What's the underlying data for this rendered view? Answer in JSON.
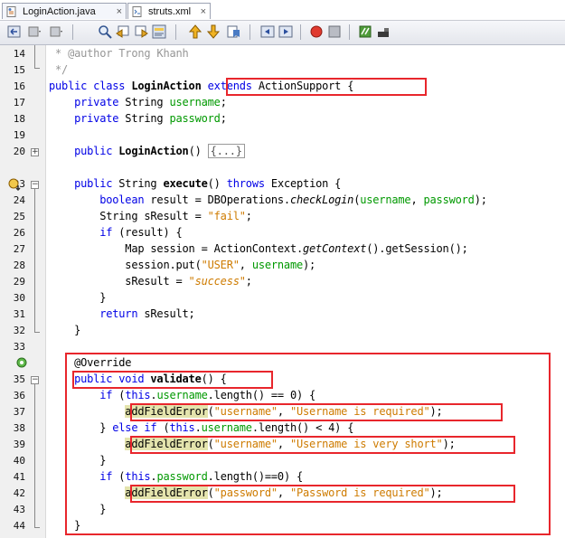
{
  "tabs": [
    {
      "label": "LoginAction.java",
      "icon": "java-file-icon",
      "close": "×",
      "active": true
    },
    {
      "label": "struts.xml",
      "icon": "xml-file-icon",
      "close": "×",
      "active": false
    }
  ],
  "toolbar": {
    "icons": [
      "back-icon",
      "history-icon",
      "forward-icon",
      "find-icon",
      "find-previous-icon",
      "find-next-icon",
      "toggle-highlight-icon",
      "previous-bookmark-icon",
      "next-bookmark-icon",
      "toggle-bookmark-icon",
      "shift-left-icon",
      "shift-right-icon",
      "start-macro-icon",
      "stop-macro-icon",
      "comment-icon",
      "uncomment-icon"
    ]
  },
  "colors": {
    "keyword": "#0000e6",
    "string": "#ce7b00",
    "field": "#009900",
    "comment": "#969696",
    "highlight": "#e4e4ad",
    "annotation_box": "#e8262c"
  },
  "code": {
    "line_numbers": [
      "14",
      "15",
      "16",
      "17",
      "18",
      "19",
      "20",
      "23",
      "24",
      "25",
      "26",
      "27",
      "28",
      "29",
      "30",
      "31",
      "32",
      "33",
      "",
      "35",
      "36",
      "37",
      "38",
      "39",
      "40",
      "41",
      "42",
      "43",
      "44"
    ],
    "lines": {
      "l14_a": " * @author Trong Khanh",
      "l15_a": " */",
      "l16_kw": "public class ",
      "l16_name": "LoginAction",
      "l16_sp": " ",
      "l16_ext": "extends",
      "l16_rest": " ActionSupport {",
      "l17_kw": "    private ",
      "l17_type": "String ",
      "l17_fld": "username",
      "l17_end": ";",
      "l18_kw": "    private ",
      "l18_type": "String ",
      "l18_fld": "password",
      "l18_end": ";",
      "l20_kw": "    public ",
      "l20_name": "LoginAction",
      "l20_paren": "() ",
      "l20_fold": "{...}",
      "l23_kw": "    public ",
      "l23_type": "String ",
      "l23_name": "execute",
      "l23_paren": "() ",
      "l23_throws": "throws",
      "l23_rest": " Exception {",
      "l24_kw": "        boolean ",
      "l24_a": "result = DBOperations.",
      "l24_m": "checkLogin",
      "l24_b": "(",
      "l24_f1": "username",
      "l24_c": ", ",
      "l24_f2": "password",
      "l24_d": ");",
      "l25_a": "        String sResult = ",
      "l25_s": "\"fail\"",
      "l25_b": ";",
      "l26_kw": "        if ",
      "l26_a": "(result) {",
      "l27_a": "            Map session = ActionContext.",
      "l27_m": "getContext",
      "l27_b": "().getSession();",
      "l28_a": "            session.put(",
      "l28_s": "\"USER\"",
      "l28_b": ", ",
      "l28_f": "username",
      "l28_c": ");",
      "l29_a": "            sResult = ",
      "l29_s": "\"success\"",
      "l29_b": ";",
      "l30_a": "        }",
      "l31_kw": "        return ",
      "l31_a": "sResult;",
      "l32_a": "    }",
      "l34_a": "    @Override",
      "l35_kw": "    public void ",
      "l35_name": "validate",
      "l35_rest": "() {",
      "l36_kw": "        if ",
      "l36_a": "(",
      "l36_this": "this",
      "l36_b": ".",
      "l36_f": "username",
      "l36_c": ".length() == 0) {",
      "l37_ind": "            ",
      "l37_call": "addFieldError",
      "l37_a": "(",
      "l37_s1": "\"username\"",
      "l37_b": ", ",
      "l37_s2": "\"Username is required\"",
      "l37_c": ");",
      "l38_a": "        } ",
      "l38_kw": "else if ",
      "l38_b": "(",
      "l38_this": "this",
      "l38_c": ".",
      "l38_f": "username",
      "l38_d": ".length() < 4) {",
      "l39_ind": "            ",
      "l39_call": "addFieldError",
      "l39_a": "(",
      "l39_s1": "\"username\"",
      "l39_b": ", ",
      "l39_s2": "\"Username is very short\"",
      "l39_c": ");",
      "l40_a": "        }",
      "l41_kw": "        if ",
      "l41_a": "(",
      "l41_this": "this",
      "l41_b": ".",
      "l41_f": "password",
      "l41_c": ".length()==0) {",
      "l42_ind": "            ",
      "l42_call": "addFieldError",
      "l42_a": "(",
      "l42_s1": "\"password\"",
      "l42_b": ", ",
      "l42_s2": "\"Password is required\"",
      "l42_c": ");",
      "l43_a": "        }",
      "l44_a": "    }"
    }
  }
}
